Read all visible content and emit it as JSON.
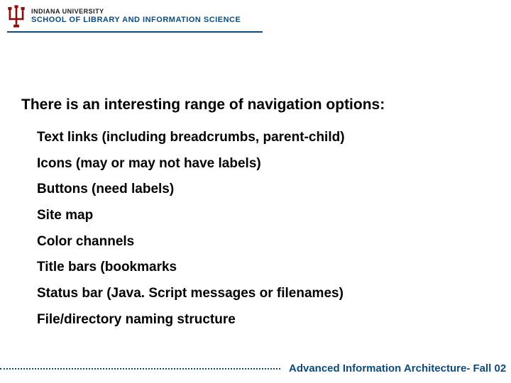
{
  "header": {
    "university": "INDIANA UNIVERSITY",
    "school": "SCHOOL OF LIBRARY AND INFORMATION SCIENCE"
  },
  "content": {
    "heading": "There is an interesting range of navigation options:",
    "items": [
      "Text links (including breadcrumbs, parent-child)",
      "Icons (may or may not have labels)",
      "Buttons (need labels)",
      "Site map",
      "Color channels",
      "Title bars (bookmarks",
      "Status bar (Java. Script messages or filenames)",
      "File/directory naming structure"
    ]
  },
  "footer": {
    "text": "Advanced Information Architecture- Fall 02"
  }
}
